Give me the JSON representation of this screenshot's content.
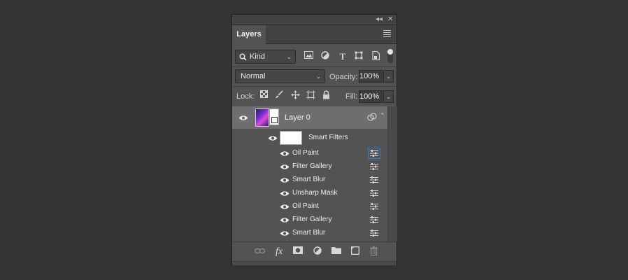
{
  "panel": {
    "tab_label": "Layers",
    "collapse_glyph": "◂◂",
    "close_glyph": "✕"
  },
  "filter_bar": {
    "kind_label": "Kind",
    "icons": [
      "image-filter-icon",
      "adjustment-filter-icon",
      "type-filter-icon",
      "shape-filter-icon",
      "smart-object-filter-icon"
    ]
  },
  "blend": {
    "mode": "Normal",
    "opacity_label": "Opacity:",
    "opacity_value": "100%"
  },
  "lock": {
    "label": "Lock:",
    "fill_label": "Fill:",
    "fill_value": "100%"
  },
  "layers": {
    "layer0_name": "Layer 0",
    "smart_filters_label": "Smart Filters",
    "filters": [
      {
        "name": "Oil Paint",
        "selected": true
      },
      {
        "name": "Filter Gallery",
        "selected": false
      },
      {
        "name": "Smart Blur",
        "selected": false
      },
      {
        "name": "Unsharp Mask",
        "selected": false
      },
      {
        "name": "Oil Paint",
        "selected": false
      },
      {
        "name": "Filter Gallery",
        "selected": false
      },
      {
        "name": "Smart Blur",
        "selected": false
      }
    ]
  },
  "bottom_bar": {
    "fx_label": "fx"
  },
  "colors": {
    "background": "#333333",
    "panel": "#535353",
    "selected_layer": "#6e6e6e",
    "accent": "#2f7ee6"
  }
}
